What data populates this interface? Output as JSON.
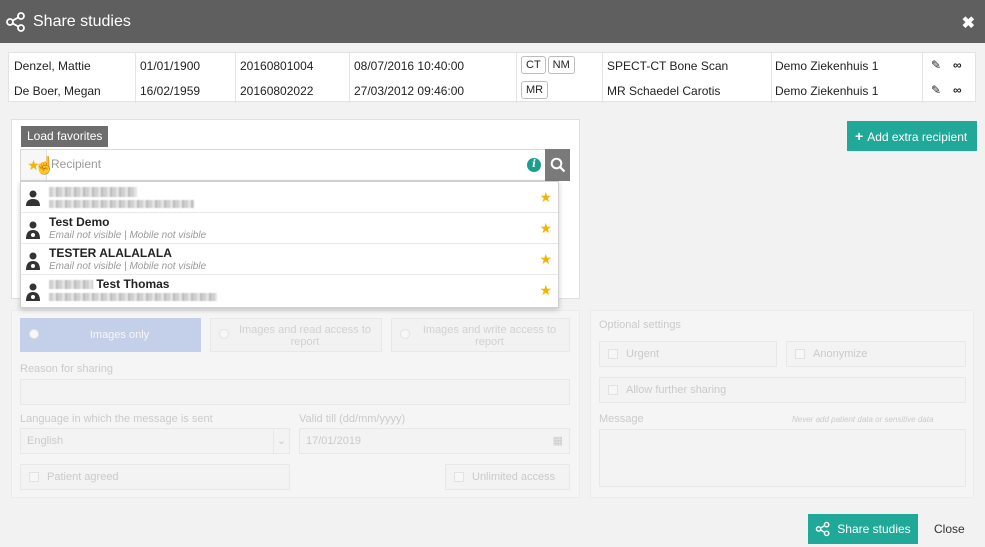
{
  "dialog": {
    "title": "Share studies",
    "close_icon": "close-icon"
  },
  "studies": [
    {
      "name": "Denzel, Mattie",
      "dob": "01/01/1900",
      "accession": "20160801004",
      "datetime": "08/07/2016 10:40:00",
      "modalities": [
        "CT",
        "NM"
      ],
      "description": "SPECT-CT Bone Scan",
      "institution": "Demo Ziekenhuis 1"
    },
    {
      "name": "De Boer, Megan",
      "dob": "16/02/1959",
      "accession": "20160802022",
      "datetime": "27/03/2012 09:46:00",
      "modalities": [
        "MR"
      ],
      "description": "MR Schaedel Carotis",
      "institution": "Demo Ziekenhuis 1"
    }
  ],
  "recipient": {
    "load_favorites": "Load favorites",
    "placeholder": "Recipient",
    "info": "i",
    "results": [
      {
        "name_prefix": "",
        "name": "",
        "sub": "",
        "icon": "person-icon"
      },
      {
        "name_prefix": "",
        "name": "Test Demo",
        "sub_email": "Email not visible",
        "sub_sep": "|",
        "sub_mobile": "Mobile not visible",
        "icon": "doctor-icon"
      },
      {
        "name_prefix": "",
        "name": "TESTER ALALALALA",
        "sub_email": "Email not visible",
        "sub_sep": "|",
        "sub_mobile": "Mobile not visible",
        "icon": "doctor-icon"
      },
      {
        "name_prefix": "",
        "name": "Test Thomas",
        "sub": "",
        "icon": "doctor-icon"
      }
    ]
  },
  "add_recipient": {
    "label": "Add extra recipient"
  },
  "access": {
    "options": [
      "Images only",
      "Images and read access to report",
      "Images and write access to report"
    ],
    "selected": "Images only"
  },
  "form": {
    "reason_label": "Reason for sharing",
    "language_label": "Language in which the message is sent",
    "language_value": "English",
    "valid_till_label": "Valid till (dd/mm/yyyy)",
    "valid_till_value": "17/01/2019",
    "patient_agreed": "Patient agreed",
    "unlimited_access": "Unlimited access"
  },
  "optional": {
    "title": "Optional settings",
    "urgent": "Urgent",
    "anonymize": "Anonymize",
    "allow_further": "Allow further sharing",
    "message_label": "Message",
    "message_hint": "Never add patient data or sensitive data"
  },
  "footer": {
    "share_label": "Share studies",
    "close_label": "Close"
  }
}
